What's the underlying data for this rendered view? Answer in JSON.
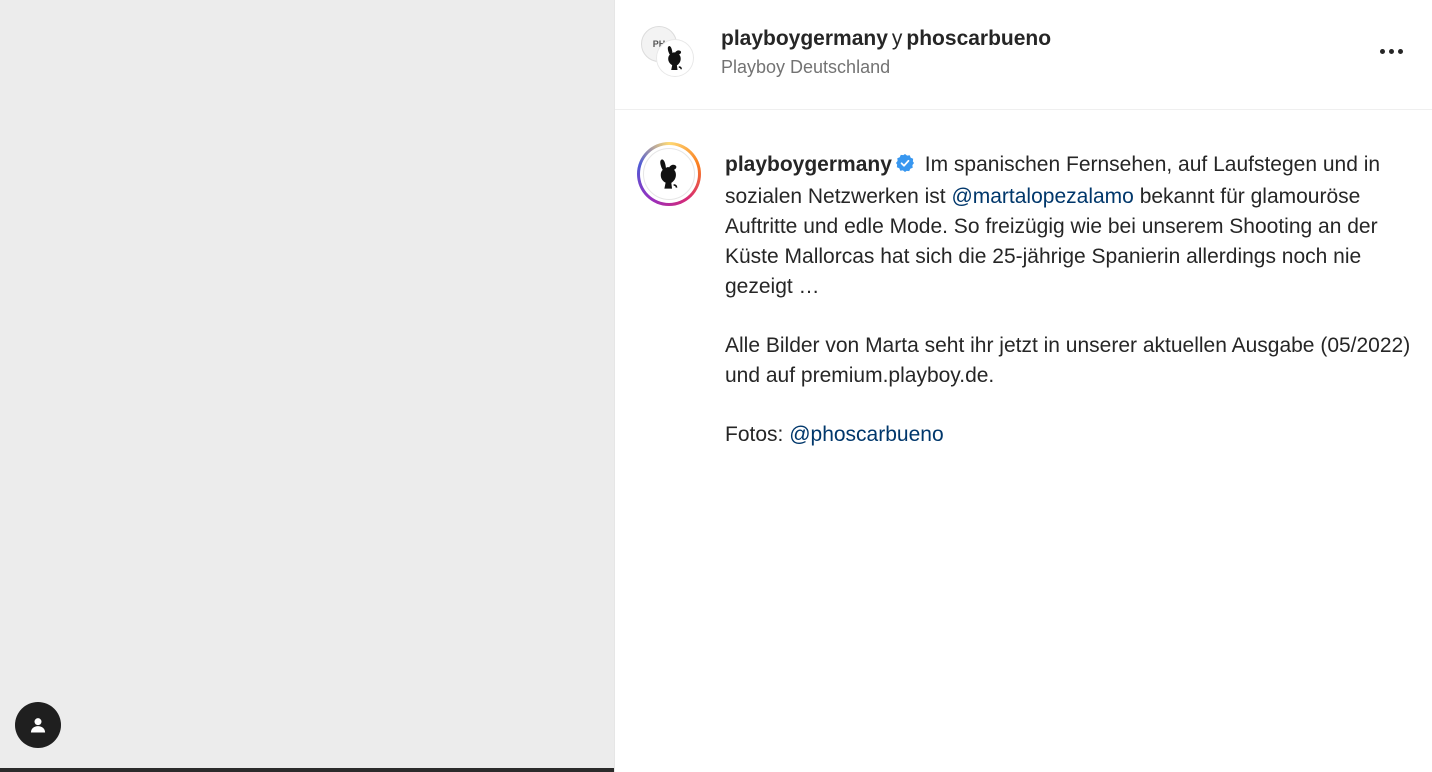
{
  "header": {
    "user_primary": "playboygermany",
    "joiner": "y",
    "user_secondary": "phoscarbueno",
    "subtitle": "Playboy Deutschland",
    "avatar_back_text": "PH",
    "more_icon": "more-horizontal-icon"
  },
  "caption": {
    "author": "playboygermany",
    "verified_icon": "verified-badge-icon",
    "text_1": "Im spanischen Fernsehen, auf Laufstegen und in sozialen Netzwerken ist",
    "mention_1": "@martalopezalamo",
    "text_2": "bekannt für glamouröse Auftritte und edle Mode. So freizügig wie bei unserem Shooting an der Küste Mallorcas hat sich die 25-jährige Spanierin allerdings noch nie gezeigt …",
    "paragraph_2": "Alle Bilder von Marta seht ihr jetzt in unserer aktuellen Ausgabe (05/2022) und auf premium.playboy.de.",
    "credit_label": "Fotos:",
    "credit_mention": "@phoscarbueno"
  },
  "media": {
    "tags_icon": "user-tag-icon"
  },
  "colors": {
    "link": "#00376b",
    "verified": "#3897f0",
    "muted": "#737373"
  }
}
